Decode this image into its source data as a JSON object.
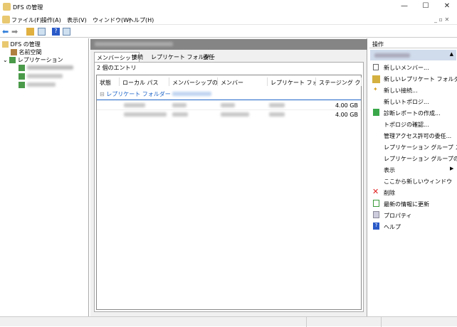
{
  "window": {
    "title": "DFS の管理",
    "minimize": "—",
    "maximize": "☐",
    "close": "✕"
  },
  "menu": [
    "ファイル(F)",
    "操作(A)",
    "表示(V)",
    "ウィンドウ(W)",
    "ヘルプ(H)"
  ],
  "tree": {
    "root": "DFS の管理",
    "namespace": "名前空間",
    "replication": "レプリケーション"
  },
  "center": {
    "tabs": [
      "メンバーシップ",
      "接続",
      "レプリケート フォルダー",
      "委任"
    ],
    "entry_count": "2 個のエントリ",
    "columns": [
      "状態",
      "ローカル パス",
      "メンバーシップの...",
      "メンバー",
      "レプリケート フォル...",
      "ステージング クォ..."
    ],
    "group_label": "レプリケート フォルダー",
    "rows": [
      {
        "staging": "4.00 GB"
      },
      {
        "staging": "4.00 GB"
      }
    ]
  },
  "actions": {
    "header": "操作",
    "items": [
      "新しいメンバー...",
      "新しいレプリケート フォルダ...",
      "新しい接続...",
      "新しいトポロジ...",
      "診断レポートの作成...",
      "トポロジの確認...",
      "管理アクセス許可の委任...",
      "レプリケーション グループ ス...",
      "レプリケーション グループの...",
      "表示",
      "ここから新しいウィンドウ",
      "削除",
      "最新の情報に更新",
      "プロパティ",
      "ヘルプ"
    ]
  },
  "colors": {
    "accent": "#1e64c8",
    "header_bar": "#858585"
  }
}
